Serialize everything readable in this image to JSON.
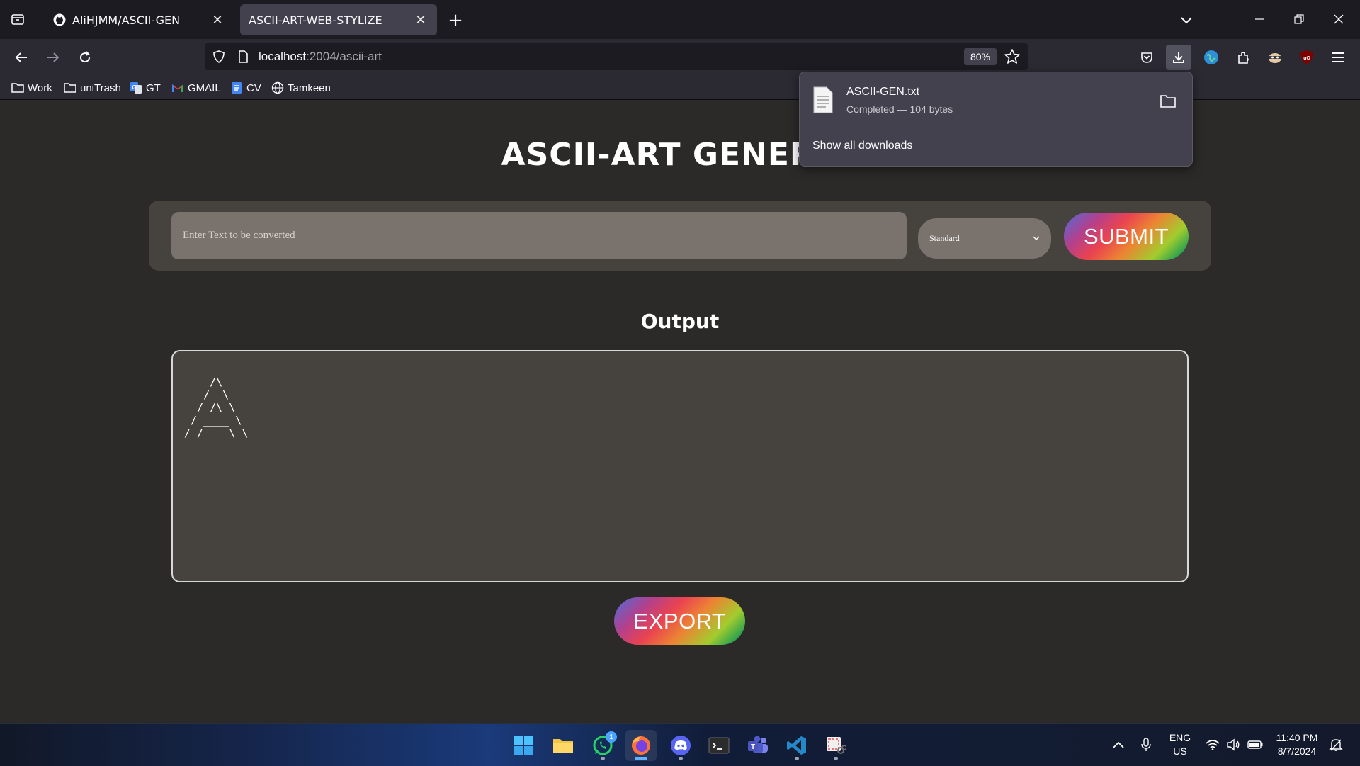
{
  "browser": {
    "tabs": [
      {
        "title": "AliHJMM/ASCII-GEN",
        "icon": "github-icon",
        "active": false
      },
      {
        "title": "ASCII-ART-WEB-STYLIZE",
        "icon": "none",
        "active": true
      }
    ],
    "url": {
      "host": "localhost",
      "rest": ":2004/ascii-art"
    },
    "zoom": "80%",
    "bookmarks": [
      {
        "label": "Work",
        "icon": "folder-icon"
      },
      {
        "label": "uniTrash",
        "icon": "folder-icon"
      },
      {
        "label": "GT",
        "icon": "google-translate-icon"
      },
      {
        "label": "GMAIL",
        "icon": "gmail-icon"
      },
      {
        "label": "CV",
        "icon": "google-docs-icon"
      },
      {
        "label": "Tamkeen",
        "icon": "globe-icon"
      }
    ]
  },
  "downloads_panel": {
    "file_name": "ASCII-GEN.txt",
    "status": "Completed — 104 bytes",
    "show_all": "Show all downloads"
  },
  "page": {
    "title": "ASCII-ART GENERAT",
    "input_placeholder": "Enter Text to be converted",
    "banner_selected": "Standard",
    "submit_label": "SUBMIT",
    "output_heading": "Output",
    "ascii_output": "    /\\\n   /  \\\n  / /\\ \\\n / ____ \\\n/_/    \\_\\",
    "export_label": "EXPORT"
  },
  "taskbar": {
    "apps": [
      "windows-start-icon",
      "file-explorer-icon",
      "whatsapp-icon",
      "firefox-icon",
      "discord-icon",
      "terminal-icon",
      "teams-icon",
      "vscode-icon",
      "snipping-tool-icon"
    ],
    "whatsapp_badge": "1",
    "lang_line1": "ENG",
    "lang_line2": "US",
    "time": "11:40 PM",
    "date": "8/7/2024"
  },
  "colors": {
    "page_bg": "#2b2a28",
    "panel_bg": "#46423d",
    "input_bg": "#79726d",
    "browser_chrome": "#2b2a33"
  }
}
